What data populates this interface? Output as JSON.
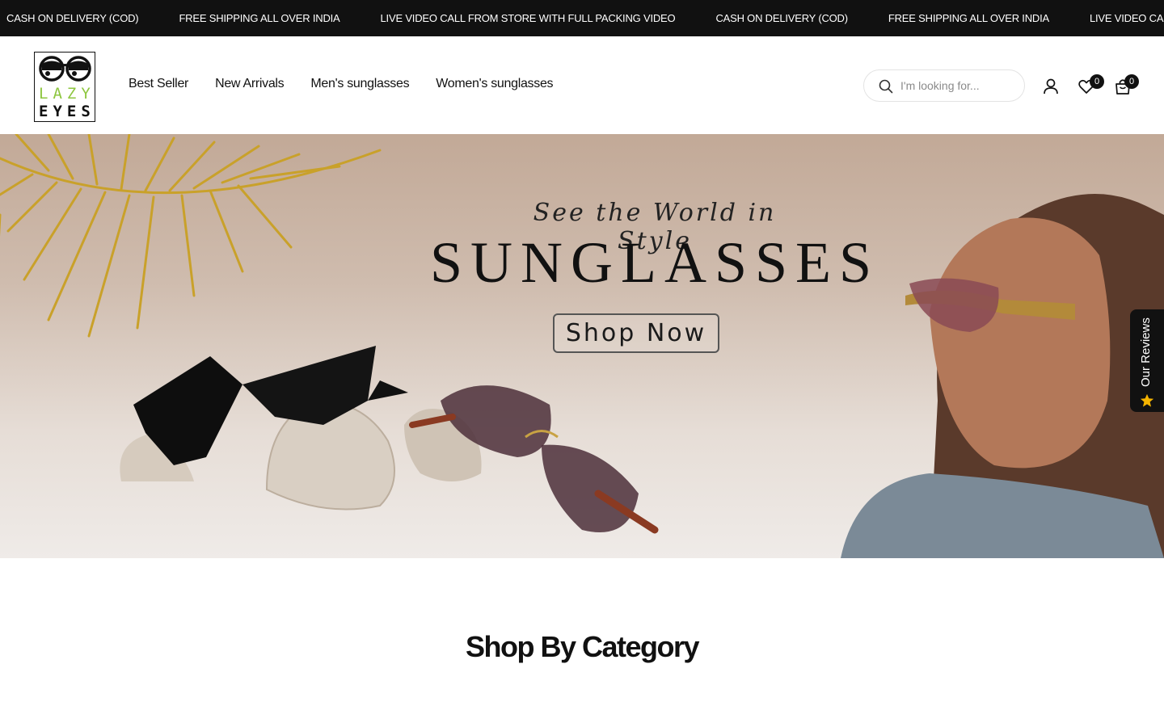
{
  "announcement": {
    "messages": [
      "CASH ON DELIVERY (COD)",
      "FREE SHIPPING ALL OVER INDIA",
      "LIVE VIDEO CALL FROM STORE WITH FULL PACKING VIDEO",
      "CASH ON DELIVERY (COD)",
      "FREE SHIPPING ALL OVER INDIA",
      "LIVE VIDEO CALL FROM STORE WITH FULL PACKING VIDEO"
    ]
  },
  "logo": {
    "line1": "LAZY",
    "line2": "EYES",
    "accent": "#8dc63f"
  },
  "nav": {
    "items": [
      {
        "label": "Best Seller"
      },
      {
        "label": "New Arrivals"
      },
      {
        "label": "Men's sunglasses"
      },
      {
        "label": "Women's sunglasses"
      }
    ]
  },
  "search": {
    "placeholder": "I'm looking for...",
    "value": "",
    "icon": "search-icon"
  },
  "header_icons": {
    "account": {
      "icon": "user-icon"
    },
    "wishlist": {
      "icon": "heart-icon",
      "count": "0"
    },
    "cart": {
      "icon": "bag-icon",
      "count": "0"
    }
  },
  "hero": {
    "tagline": "See the World in Style",
    "headline": "SUNGLASSES",
    "cta_label": "Shop Now"
  },
  "reviews_tab": {
    "label": "Our Reviews",
    "icon": "star-icon",
    "star_color": "#f5b400"
  },
  "sections": {
    "category_title": "Shop By Category"
  },
  "colors": {
    "announcement_bg": "#111111",
    "text": "#111111"
  }
}
